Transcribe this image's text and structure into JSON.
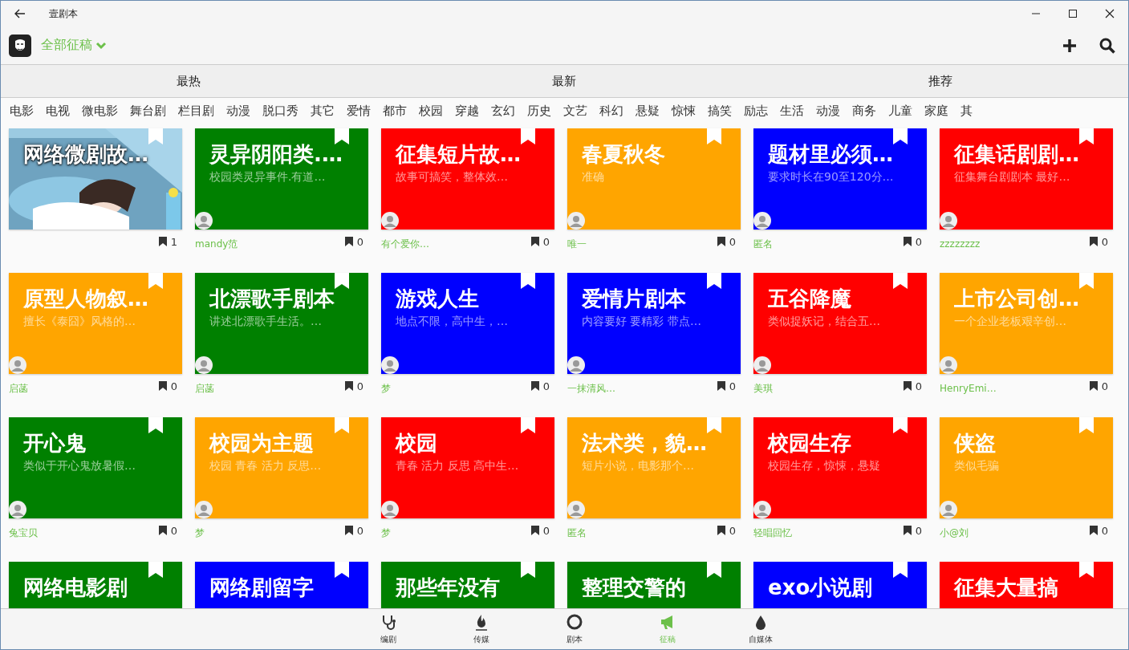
{
  "window": {
    "title": "壹剧本"
  },
  "header": {
    "filter": "全部征稿"
  },
  "tabs": [
    {
      "label": "最热"
    },
    {
      "label": "最新"
    },
    {
      "label": "推荐"
    }
  ],
  "categories": [
    "电影",
    "电视",
    "微电影",
    "舞台剧",
    "栏目剧",
    "动漫",
    "脱口秀",
    "其它",
    "爱情",
    "都市",
    "校园",
    "穿越",
    "玄幻",
    "历史",
    "文艺",
    "科幻",
    "悬疑",
    "惊悚",
    "搞笑",
    "励志",
    "生活",
    "动漫",
    "商务",
    "儿童",
    "家庭",
    "其"
  ],
  "cards": [
    {
      "kind": "picture",
      "title": "网络微剧故…",
      "count": "1"
    },
    {
      "kind": "color",
      "color": "#008000",
      "title": "灵异阴阳类.…",
      "subtitle": "校园类灵异事件.有道…",
      "author": "mandy范",
      "count": "0"
    },
    {
      "kind": "color",
      "color": "#ff0000",
      "title": "征集短片故…",
      "subtitle": "故事可搞笑，整体效…",
      "author": "有个爱你…",
      "count": "0"
    },
    {
      "kind": "color",
      "color": "#ffa500",
      "title": "春夏秋冬",
      "subtitle": "准确",
      "author": "唯一",
      "count": "0"
    },
    {
      "kind": "color",
      "color": "#0000ff",
      "title": "题材里必须…",
      "subtitle": "要求时长在90至120分…",
      "author": "匿名",
      "count": "0"
    },
    {
      "kind": "color",
      "color": "#ff0000",
      "title": "征集话剧剧…",
      "subtitle": "征集舞台剧剧本 最好…",
      "author": "zzzzzzzz",
      "count": "0"
    },
    {
      "kind": "color",
      "color": "#ffa500",
      "title": "原型人物叙…",
      "subtitle": "擅长《泰囧》风格的…",
      "author": "启菡",
      "count": "0"
    },
    {
      "kind": "color",
      "color": "#008000",
      "title": "北漂歌手剧本",
      "subtitle": "讲述北漂歌手生活。…",
      "author": "启菡",
      "count": "0"
    },
    {
      "kind": "color",
      "color": "#0000ff",
      "title": "游戏人生",
      "subtitle": "地点不限，高中生，…",
      "author": "梦",
      "count": "0"
    },
    {
      "kind": "color",
      "color": "#0000ff",
      "title": "爱情片剧本",
      "subtitle": "内容要好 要精彩 带点…",
      "author": "一抹清风…",
      "count": "0"
    },
    {
      "kind": "color",
      "color": "#ff0000",
      "title": "五谷降魔",
      "subtitle": "类似捉妖记，结合五…",
      "author": "美琪",
      "count": "0"
    },
    {
      "kind": "color",
      "color": "#ffa500",
      "title": "上市公司创…",
      "subtitle": "一个企业老板艰辛创…",
      "author": "HenryEmi…",
      "count": "0"
    },
    {
      "kind": "color",
      "color": "#008000",
      "title": "开心鬼",
      "subtitle": "类似于开心鬼放暑假…",
      "author": "兔宝贝",
      "count": "0"
    },
    {
      "kind": "color",
      "color": "#ffa500",
      "title": "校园为主题",
      "subtitle": "校园 青春 活力 反思…",
      "author": "梦",
      "count": "0"
    },
    {
      "kind": "color",
      "color": "#ff0000",
      "title": "校园",
      "subtitle": "青春 活力 反思 高中生…",
      "author": "梦",
      "count": "0"
    },
    {
      "kind": "color",
      "color": "#ffa500",
      "title": "法术类，貌…",
      "subtitle": "短片小说，电影那个…",
      "author": "匿名",
      "count": "0"
    },
    {
      "kind": "color",
      "color": "#ff0000",
      "title": "校园生存",
      "subtitle": "校园生存，惊悚，悬疑",
      "author": "轻唱回忆",
      "count": "0"
    },
    {
      "kind": "color",
      "color": "#ffa500",
      "title": "侠盗",
      "subtitle": "类似毛骗",
      "author": "小@刘",
      "count": "0"
    },
    {
      "kind": "color",
      "color": "#008000",
      "title": "网络电影剧"
    },
    {
      "kind": "color",
      "color": "#0000ff",
      "title": "网络剧留字"
    },
    {
      "kind": "color",
      "color": "#008000",
      "title": "那些年没有"
    },
    {
      "kind": "color",
      "color": "#008000",
      "title": "整理交警的"
    },
    {
      "kind": "color",
      "color": "#0000ff",
      "title": "exo小说剧"
    },
    {
      "kind": "color",
      "color": "#ff0000",
      "title": "征集大量搞"
    }
  ],
  "bottom_nav": [
    {
      "kind": "stethoscope",
      "label": "编剧",
      "selected": false
    },
    {
      "kind": "flame",
      "label": "传媒",
      "selected": false
    },
    {
      "kind": "circle",
      "label": "剧本",
      "selected": false
    },
    {
      "kind": "megaphone",
      "label": "征稿",
      "selected": true
    },
    {
      "kind": "drop",
      "label": "自媒体",
      "selected": false
    }
  ]
}
